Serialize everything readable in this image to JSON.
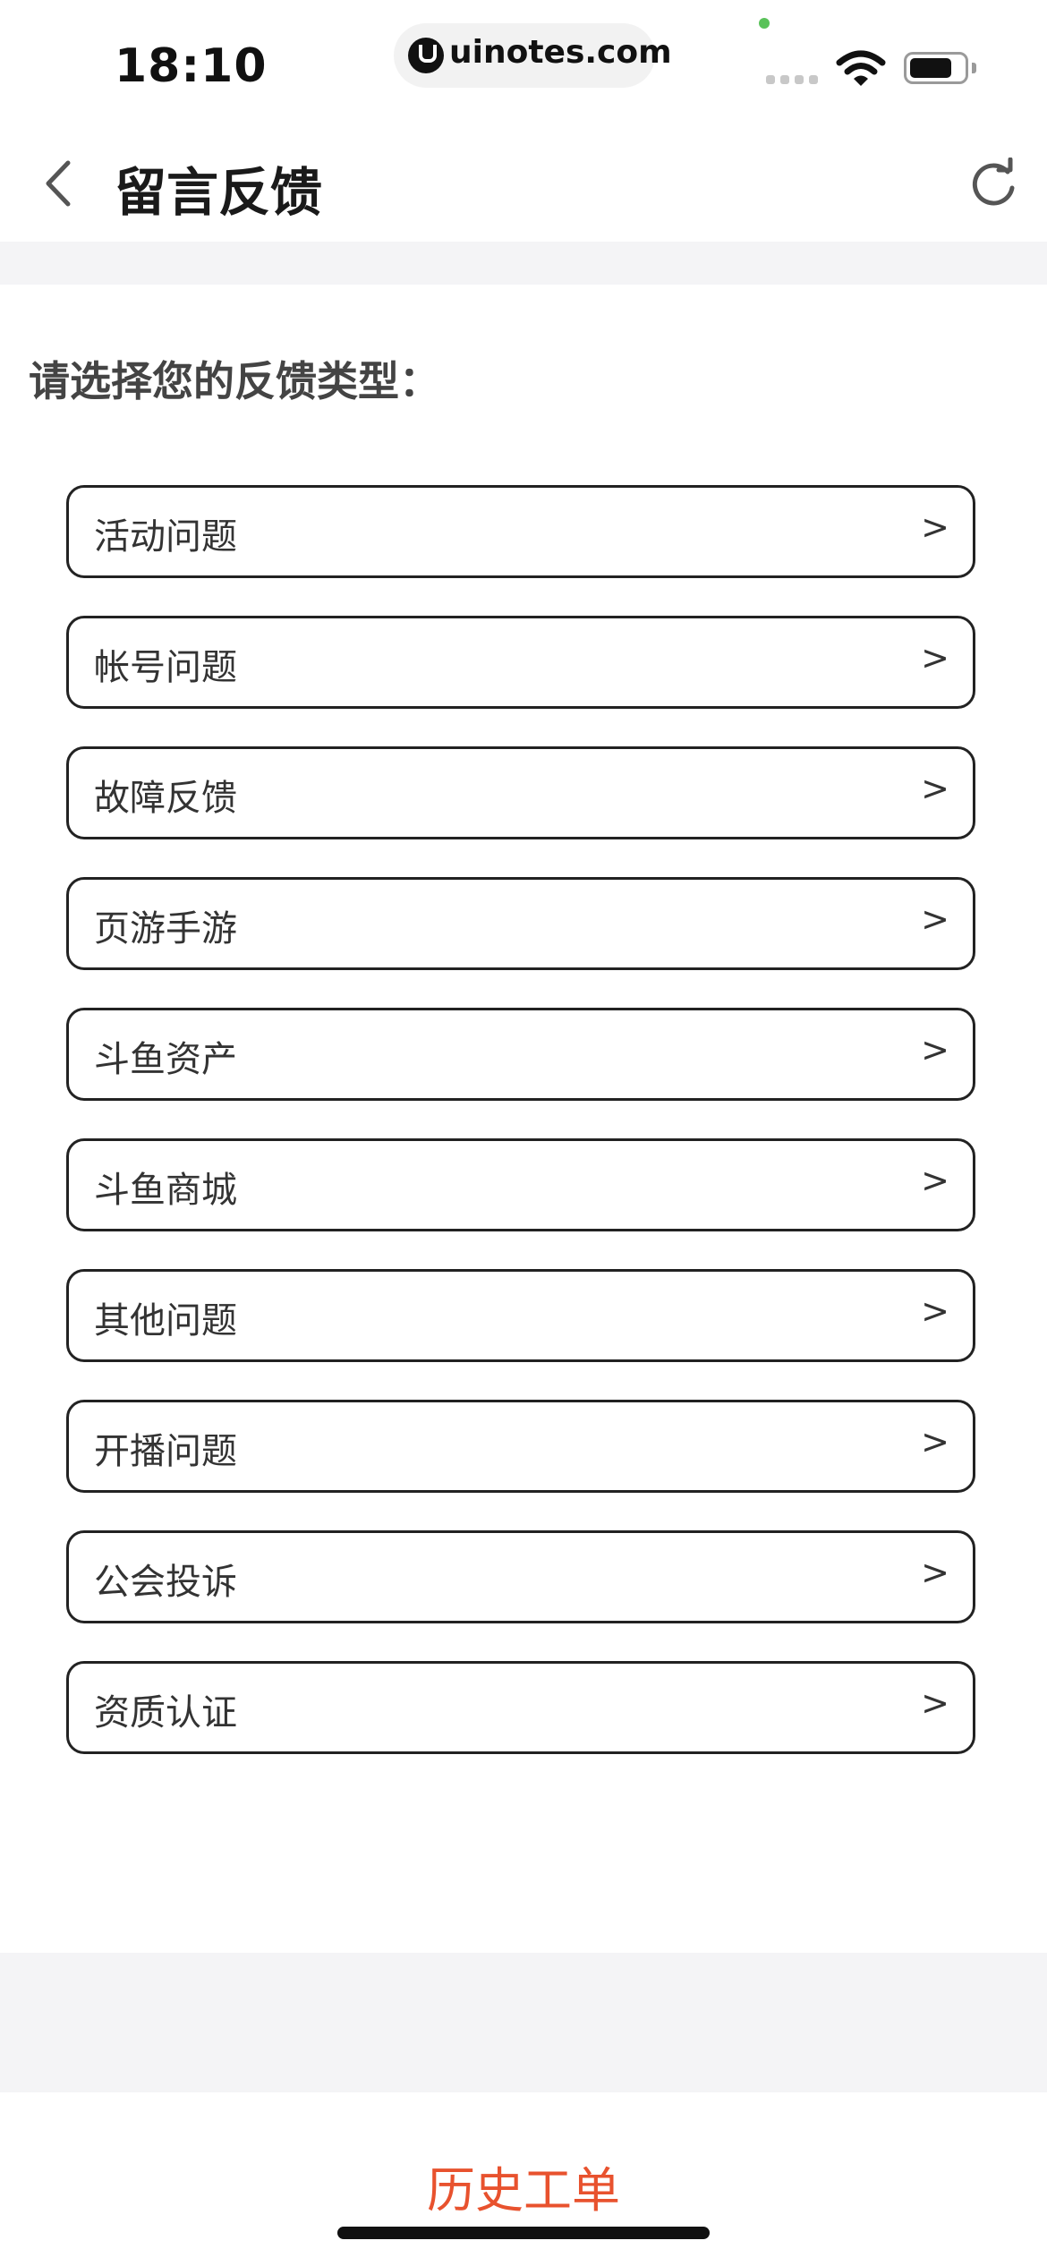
{
  "status_bar": {
    "time": "18:10",
    "url": "uinotes.com",
    "battery_level": 0.8
  },
  "nav": {
    "title": "留言反馈",
    "back_icon": "chevron-left-icon",
    "refresh_icon": "refresh-icon"
  },
  "content": {
    "prompt": "请选择您的反馈类型：",
    "arrow": ">",
    "options": [
      {
        "label": "活动问题"
      },
      {
        "label": "帐号问题"
      },
      {
        "label": "故障反馈"
      },
      {
        "label": "页游手游"
      },
      {
        "label": "斗鱼资产"
      },
      {
        "label": "斗鱼商城"
      },
      {
        "label": "其他问题"
      },
      {
        "label": "开播问题"
      },
      {
        "label": "公会投诉"
      },
      {
        "label": "资质认证"
      }
    ]
  },
  "footer": {
    "history_label": "历史工单"
  },
  "colors": {
    "accent": "#e8522e",
    "border": "#222222",
    "background_gray": "#f4f4f6"
  }
}
